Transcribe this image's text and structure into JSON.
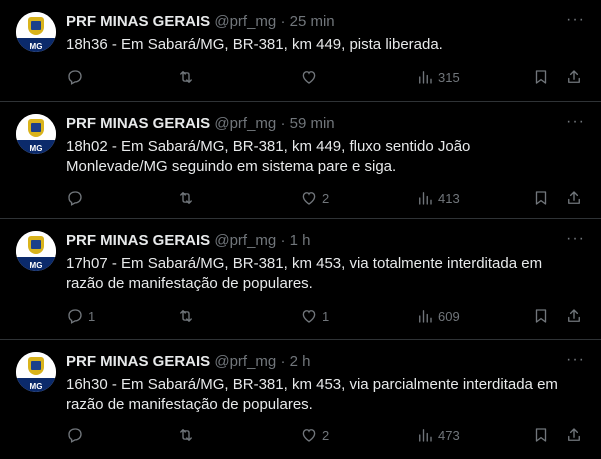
{
  "tweets": [
    {
      "name": "PRF MINAS GERAIS",
      "handle": "@prf_mg",
      "separator": "·",
      "time": "25 min",
      "text": "18h36 - Em Sabará/MG, BR-381, km 449, pista liberada.",
      "replies": "",
      "retweets": "",
      "likes": "",
      "views": "315"
    },
    {
      "name": "PRF MINAS GERAIS",
      "handle": "@prf_mg",
      "separator": "·",
      "time": "59 min",
      "text": "18h02 - Em Sabará/MG, BR-381, km 449, fluxo sentido João Monlevade/MG seguindo em sistema pare e siga.",
      "replies": "",
      "retweets": "",
      "likes": "2",
      "views": "413"
    },
    {
      "name": "PRF MINAS GERAIS",
      "handle": "@prf_mg",
      "separator": "·",
      "time": "1 h",
      "text": "17h07 - Em Sabará/MG, BR-381, km 453, via totalmente  interditada em razão de manifestação de populares.",
      "replies": "1",
      "retweets": "",
      "likes": "1",
      "views": "609"
    },
    {
      "name": "PRF MINAS GERAIS",
      "handle": "@prf_mg",
      "separator": "·",
      "time": "2 h",
      "text": "16h30 - Em Sabará/MG, BR-381, km 453, via parcialmente interditada em razão de manifestação de populares.",
      "replies": "",
      "retweets": "",
      "likes": "2",
      "views": "473"
    }
  ],
  "avatar_text": "MG",
  "avatar_badge_text": "PRF",
  "colors": {
    "background": "#000000",
    "text": "#e7e9ea",
    "muted": "#71767b",
    "divider": "#2f3336"
  },
  "icons": [
    "reply-icon",
    "retweet-icon",
    "like-icon",
    "views-icon",
    "bookmark-icon",
    "share-icon",
    "more-icon"
  ]
}
